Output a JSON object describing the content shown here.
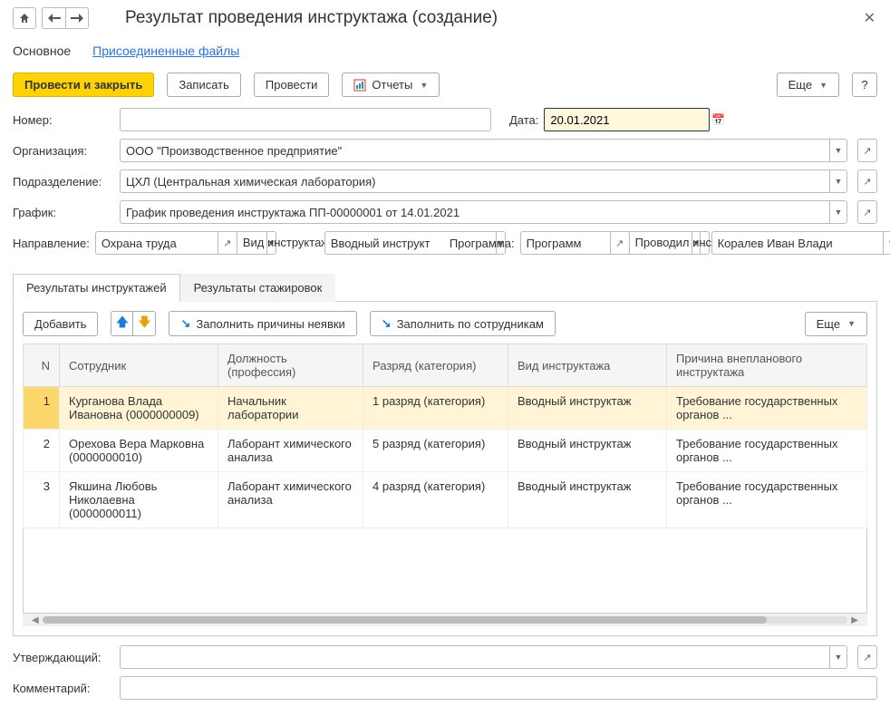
{
  "header": {
    "title": "Результат проведения инструктажа (создание)"
  },
  "navTabs": {
    "main": "Основное",
    "attached": "Присоединенные файлы"
  },
  "toolbar": {
    "postClose": "Провести и закрыть",
    "write": "Записать",
    "post": "Провести",
    "reports": "Отчеты",
    "more": "Еще",
    "help": "?"
  },
  "fields": {
    "numberLabel": "Номер:",
    "numberValue": "",
    "dateLabel": "Дата:",
    "dateValue": "20.01.2021",
    "orgLabel": "Организация:",
    "orgValue": "ООО \"Производственное предприятие\"",
    "deptLabel": "Подразделение:",
    "deptValue": "ЦХЛ (Центральная химическая лаборатория)",
    "schedLabel": "График:",
    "schedValue": "График проведения инструктажа ПП-00000001 от 14.01.2021",
    "directionLabel": "Направление:",
    "directionValue": "Охрана труда",
    "typeLabel": "Вид инструктажа:",
    "typeValue": "Вводный инструкт",
    "programLabel": "Программа:",
    "programValue": "Программ",
    "conductorLabel": "Проводил инструктаж:",
    "conductorValue": "Коралев Иван Влади"
  },
  "subTabs": {
    "results": "Результаты инструктажей",
    "intern": "Результаты стажировок"
  },
  "tableToolbar": {
    "add": "Добавить",
    "fillReasons": "Заполнить причины неявки",
    "fillEmployees": "Заполнить по сотрудникам",
    "more": "Еще"
  },
  "table": {
    "headers": {
      "n": "N",
      "employee": "Сотрудник",
      "position": "Должность (профессия)",
      "grade": "Разряд (категория)",
      "type": "Вид инструктажа",
      "reason": "Причина внепланового инструктажа"
    },
    "rows": [
      {
        "n": "1",
        "employee": "Курганова Влада Ивановна (0000000009)",
        "position": "Начальник лаборатории",
        "grade": "1 разряд (категория)",
        "type": "Вводный инструктаж",
        "reason": "Требование государственных органов ..."
      },
      {
        "n": "2",
        "employee": "Орехова Вера Марковна (0000000010)",
        "position": "Лаборант химического анализа",
        "grade": "5 разряд (категория)",
        "type": "Вводный инструктаж",
        "reason": "Требование государственных органов ..."
      },
      {
        "n": "3",
        "employee": "Якшина Любовь Николаевна (0000000011)",
        "position": "Лаборант химического анализа",
        "grade": "4 разряд (категория)",
        "type": "Вводный инструктаж",
        "reason": "Требование государственных органов ..."
      }
    ]
  },
  "footer": {
    "approverLabel": "Утверждающий:",
    "approverValue": "",
    "commentLabel": "Комментарий:",
    "commentValue": ""
  }
}
